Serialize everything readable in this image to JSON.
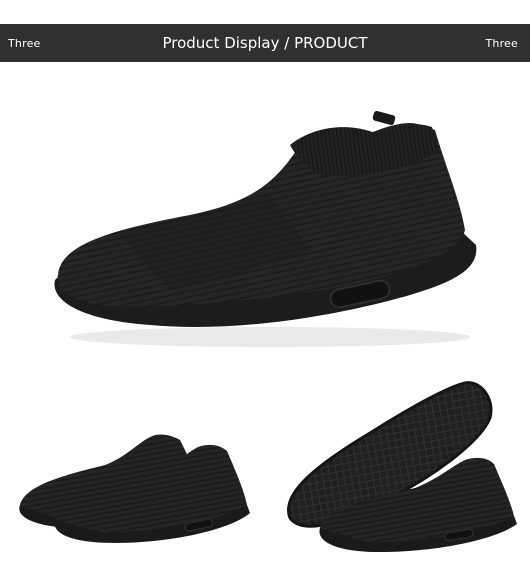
{
  "banner": {
    "left_label": "Three",
    "title": "Product Display / PRODUCT",
    "right_label": "Three"
  },
  "colors": {
    "banner_bg": "#303030",
    "banner_text": "#ffffff",
    "shoe_knit": "#232323",
    "shoe_sole": "#1c1c1c"
  }
}
